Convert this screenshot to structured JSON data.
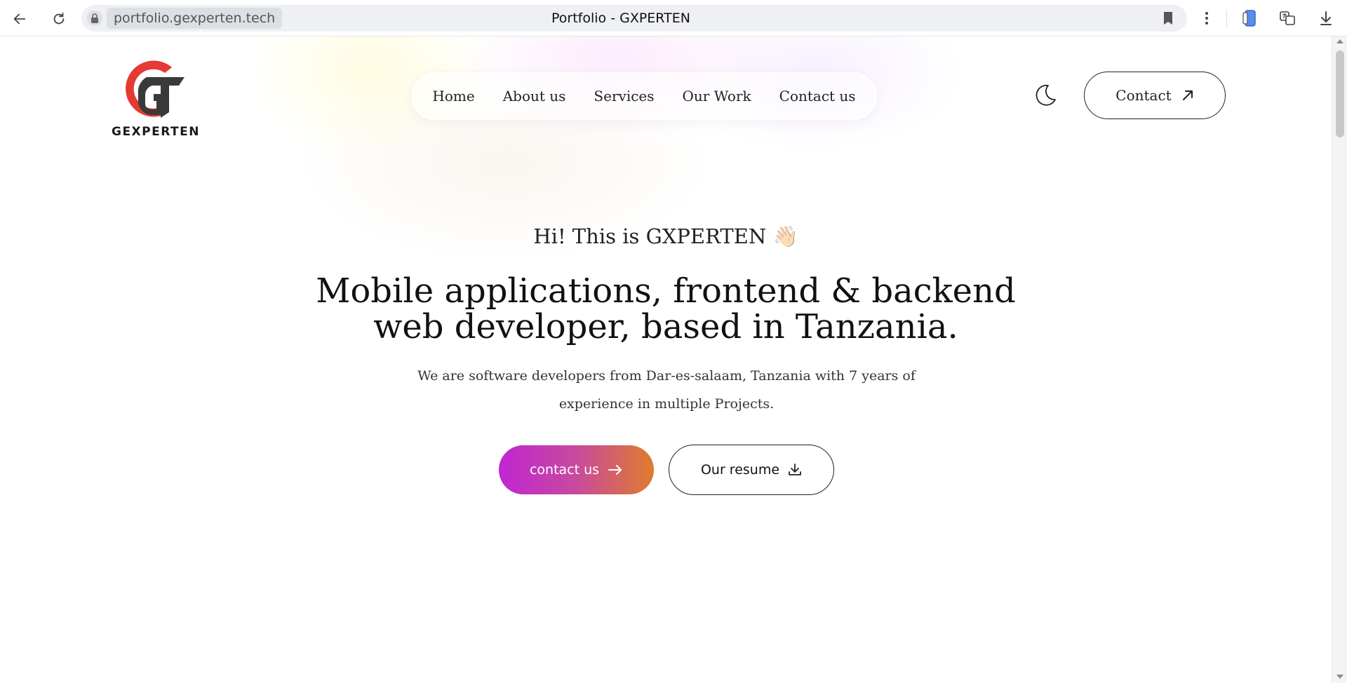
{
  "browser": {
    "url": "portfolio.gexperten.tech",
    "tab_title": "Portfolio - GXPERTEN",
    "icons": [
      "back-icon",
      "reload-icon",
      "lock-icon",
      "bookmark-icon",
      "more-icon",
      "phone-icon",
      "translate-icon",
      "download-icon"
    ]
  },
  "logo": {
    "text": "GEXPERTEN",
    "colors": {
      "red": "#e53935",
      "dark": "#3a3a3a"
    }
  },
  "nav": {
    "items": [
      {
        "label": "Home"
      },
      {
        "label": "About us"
      },
      {
        "label": "Services"
      },
      {
        "label": "Our Work"
      },
      {
        "label": "Contact us"
      }
    ]
  },
  "header": {
    "theme_toggle_icon": "moon-icon",
    "contact_label": "Contact",
    "contact_icon": "arrow-up-right-icon"
  },
  "hero": {
    "greeting": "Hi! This is GXPERTEN",
    "greeting_emoji": "👋🏻",
    "headline_line1": "Mobile applications, frontend & backend",
    "headline_line2": "web developer, based in Tanzania.",
    "description": "We are software developers from Dar-es-salaam, Tanzania with 7 years of experience in multiple Projects.",
    "primary_button": {
      "label": "contact us",
      "icon": "arrow-right-icon"
    },
    "secondary_button": {
      "label": "Our resume",
      "icon": "download-icon"
    }
  },
  "colors": {
    "gradient_start": "#c026d3",
    "gradient_end": "#e07c2c",
    "text": "#111111"
  }
}
